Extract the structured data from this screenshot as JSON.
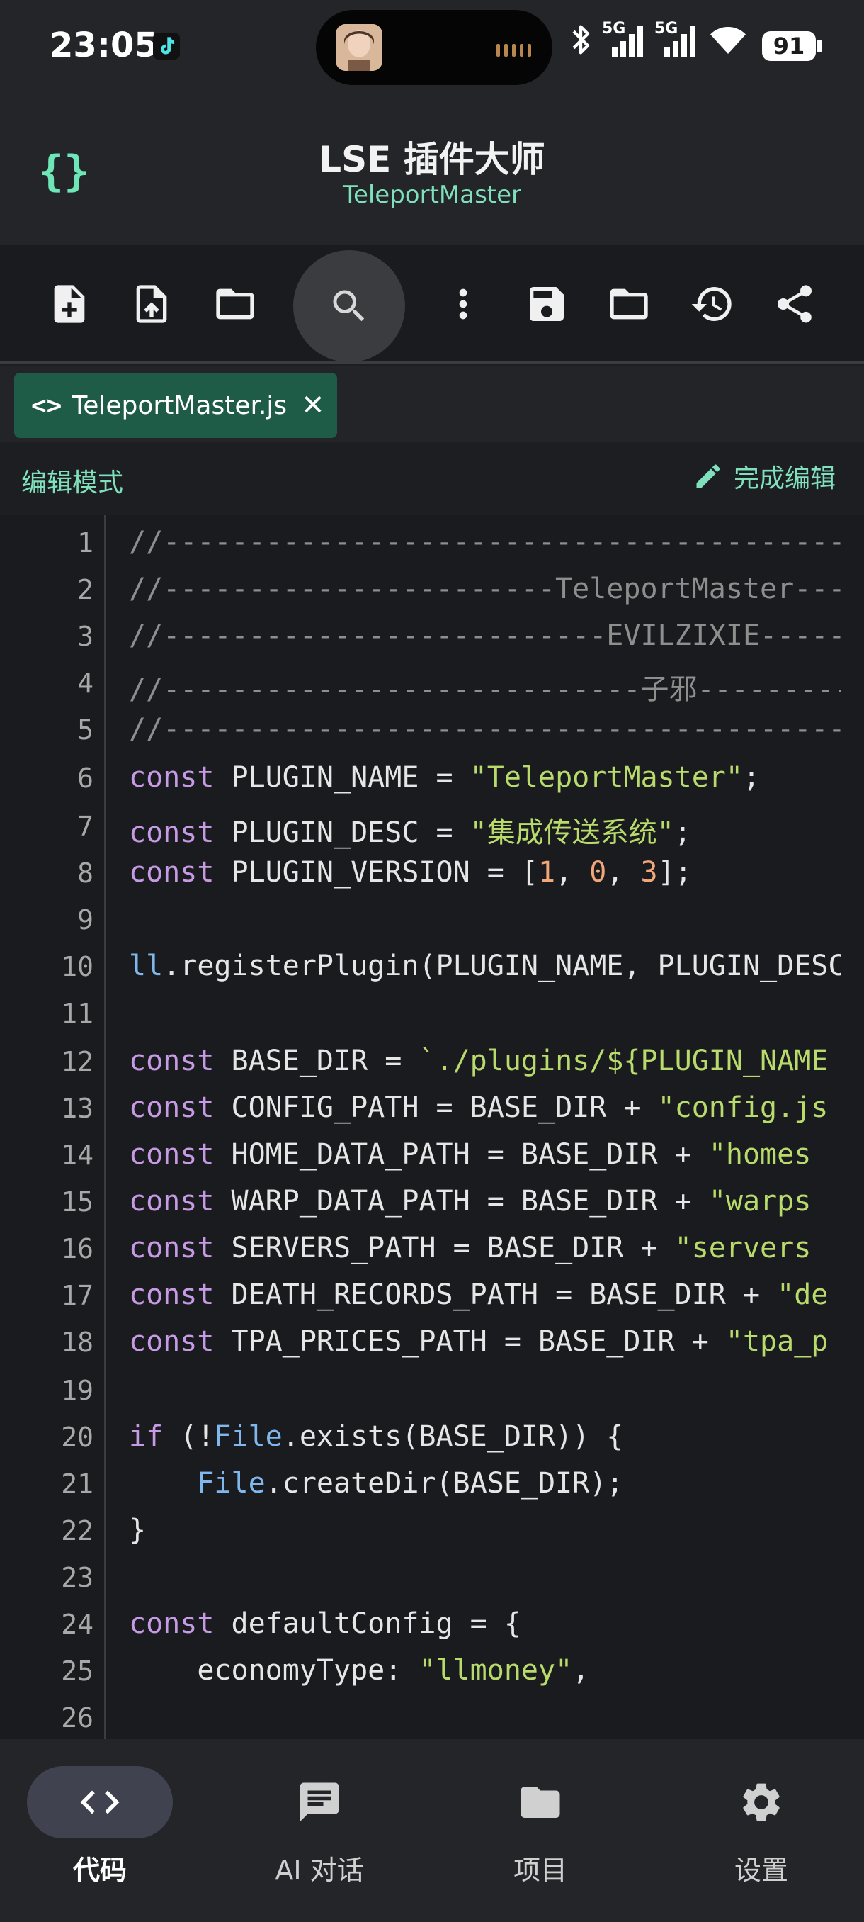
{
  "status_bar": {
    "time": "23:05",
    "network_1": "5G",
    "network_2": "5G",
    "battery": "91"
  },
  "header": {
    "title": "LSE 插件大师",
    "subtitle": "TeleportMaster"
  },
  "tab": {
    "filename": "TeleportMaster.js",
    "close": "✕"
  },
  "mode": {
    "label": "编辑模式",
    "done_label": "完成编辑"
  },
  "editor": {
    "lines": [
      {
        "n": "1",
        "tokens": [
          [
            "cm",
            "//----------------------------------------"
          ]
        ]
      },
      {
        "n": "2",
        "tokens": [
          [
            "cm",
            "//-----------------------TeleportMaster-----"
          ]
        ]
      },
      {
        "n": "3",
        "tokens": [
          [
            "cm",
            "//--------------------------EVILZIXIE--------"
          ]
        ]
      },
      {
        "n": "4",
        "tokens": [
          [
            "cm",
            "//----------------------------子邪------------"
          ]
        ]
      },
      {
        "n": "5",
        "tokens": [
          [
            "cm",
            "//----------------------------------------"
          ]
        ]
      },
      {
        "n": "6",
        "tokens": [
          [
            "kw",
            "const"
          ],
          [
            "",
            " PLUGIN_NAME = "
          ],
          [
            "str",
            "\"TeleportMaster\""
          ],
          [
            "",
            ";"
          ]
        ]
      },
      {
        "n": "7",
        "tokens": [
          [
            "kw",
            "const"
          ],
          [
            "",
            " PLUGIN_DESC = "
          ],
          [
            "str",
            "\"集成传送系统\""
          ],
          [
            "",
            ";"
          ]
        ]
      },
      {
        "n": "8",
        "tokens": [
          [
            "kw",
            "const"
          ],
          [
            "",
            " PLUGIN_VERSION = ["
          ],
          [
            "num",
            "1"
          ],
          [
            "",
            ", "
          ],
          [
            "num",
            "0"
          ],
          [
            "",
            ", "
          ],
          [
            "num",
            "3"
          ],
          [
            "",
            "];"
          ]
        ]
      },
      {
        "n": "9",
        "tokens": []
      },
      {
        "n": "10",
        "tokens": [
          [
            "obj",
            "ll"
          ],
          [
            "",
            ".registerPlugin(PLUGIN_NAME, PLUGIN_DESC"
          ]
        ]
      },
      {
        "n": "11",
        "tokens": []
      },
      {
        "n": "12",
        "tokens": [
          [
            "kw",
            "const"
          ],
          [
            "",
            " BASE_DIR = "
          ],
          [
            "str",
            "`./plugins/${PLUGIN_NAME"
          ]
        ]
      },
      {
        "n": "13",
        "tokens": [
          [
            "kw",
            "const"
          ],
          [
            "",
            " CONFIG_PATH = BASE_DIR + "
          ],
          [
            "str",
            "\"config.js"
          ]
        ]
      },
      {
        "n": "14",
        "tokens": [
          [
            "kw",
            "const"
          ],
          [
            "",
            " HOME_DATA_PATH = BASE_DIR + "
          ],
          [
            "str",
            "\"homes"
          ]
        ]
      },
      {
        "n": "15",
        "tokens": [
          [
            "kw",
            "const"
          ],
          [
            "",
            " WARP_DATA_PATH = BASE_DIR + "
          ],
          [
            "str",
            "\"warps"
          ]
        ]
      },
      {
        "n": "16",
        "tokens": [
          [
            "kw",
            "const"
          ],
          [
            "",
            " SERVERS_PATH = BASE_DIR + "
          ],
          [
            "str",
            "\"servers"
          ]
        ]
      },
      {
        "n": "17",
        "tokens": [
          [
            "kw",
            "const"
          ],
          [
            "",
            " DEATH_RECORDS_PATH = BASE_DIR + "
          ],
          [
            "str",
            "\"de"
          ]
        ]
      },
      {
        "n": "18",
        "tokens": [
          [
            "kw",
            "const"
          ],
          [
            "",
            " TPA_PRICES_PATH = BASE_DIR + "
          ],
          [
            "str",
            "\"tpa_p"
          ]
        ]
      },
      {
        "n": "19",
        "tokens": []
      },
      {
        "n": "20",
        "tokens": [
          [
            "kw",
            "if"
          ],
          [
            "",
            " (!"
          ],
          [
            "obj",
            "File"
          ],
          [
            "",
            ".exists(BASE_DIR)) {"
          ]
        ]
      },
      {
        "n": "21",
        "tokens": [
          [
            "",
            "    "
          ],
          [
            "obj",
            "File"
          ],
          [
            "",
            ".createDir(BASE_DIR);"
          ]
        ]
      },
      {
        "n": "22",
        "tokens": [
          [
            "",
            "}"
          ]
        ]
      },
      {
        "n": "23",
        "tokens": []
      },
      {
        "n": "24",
        "tokens": [
          [
            "kw",
            "const"
          ],
          [
            "",
            " defaultConfig = {"
          ]
        ]
      },
      {
        "n": "25",
        "tokens": [
          [
            "",
            "    economyType: "
          ],
          [
            "str",
            "\"llmoney\""
          ],
          [
            "",
            ","
          ]
        ]
      },
      {
        "n": "26",
        "tokens": []
      }
    ]
  },
  "bottom_nav": [
    {
      "label": "代码",
      "icon": "code-icon",
      "active": true
    },
    {
      "label": "AI 对话",
      "icon": "chat-icon",
      "active": false
    },
    {
      "label": "项目",
      "icon": "folder-icon",
      "active": false
    },
    {
      "label": "设置",
      "icon": "gear-icon",
      "active": false
    }
  ],
  "colors": {
    "accent": "#7fe0bb",
    "tab_active": "#1f5c48",
    "keyword": "#c79ae6",
    "string": "#b8db6c",
    "number": "#f2a77a",
    "comment": "#8e8e8e"
  }
}
